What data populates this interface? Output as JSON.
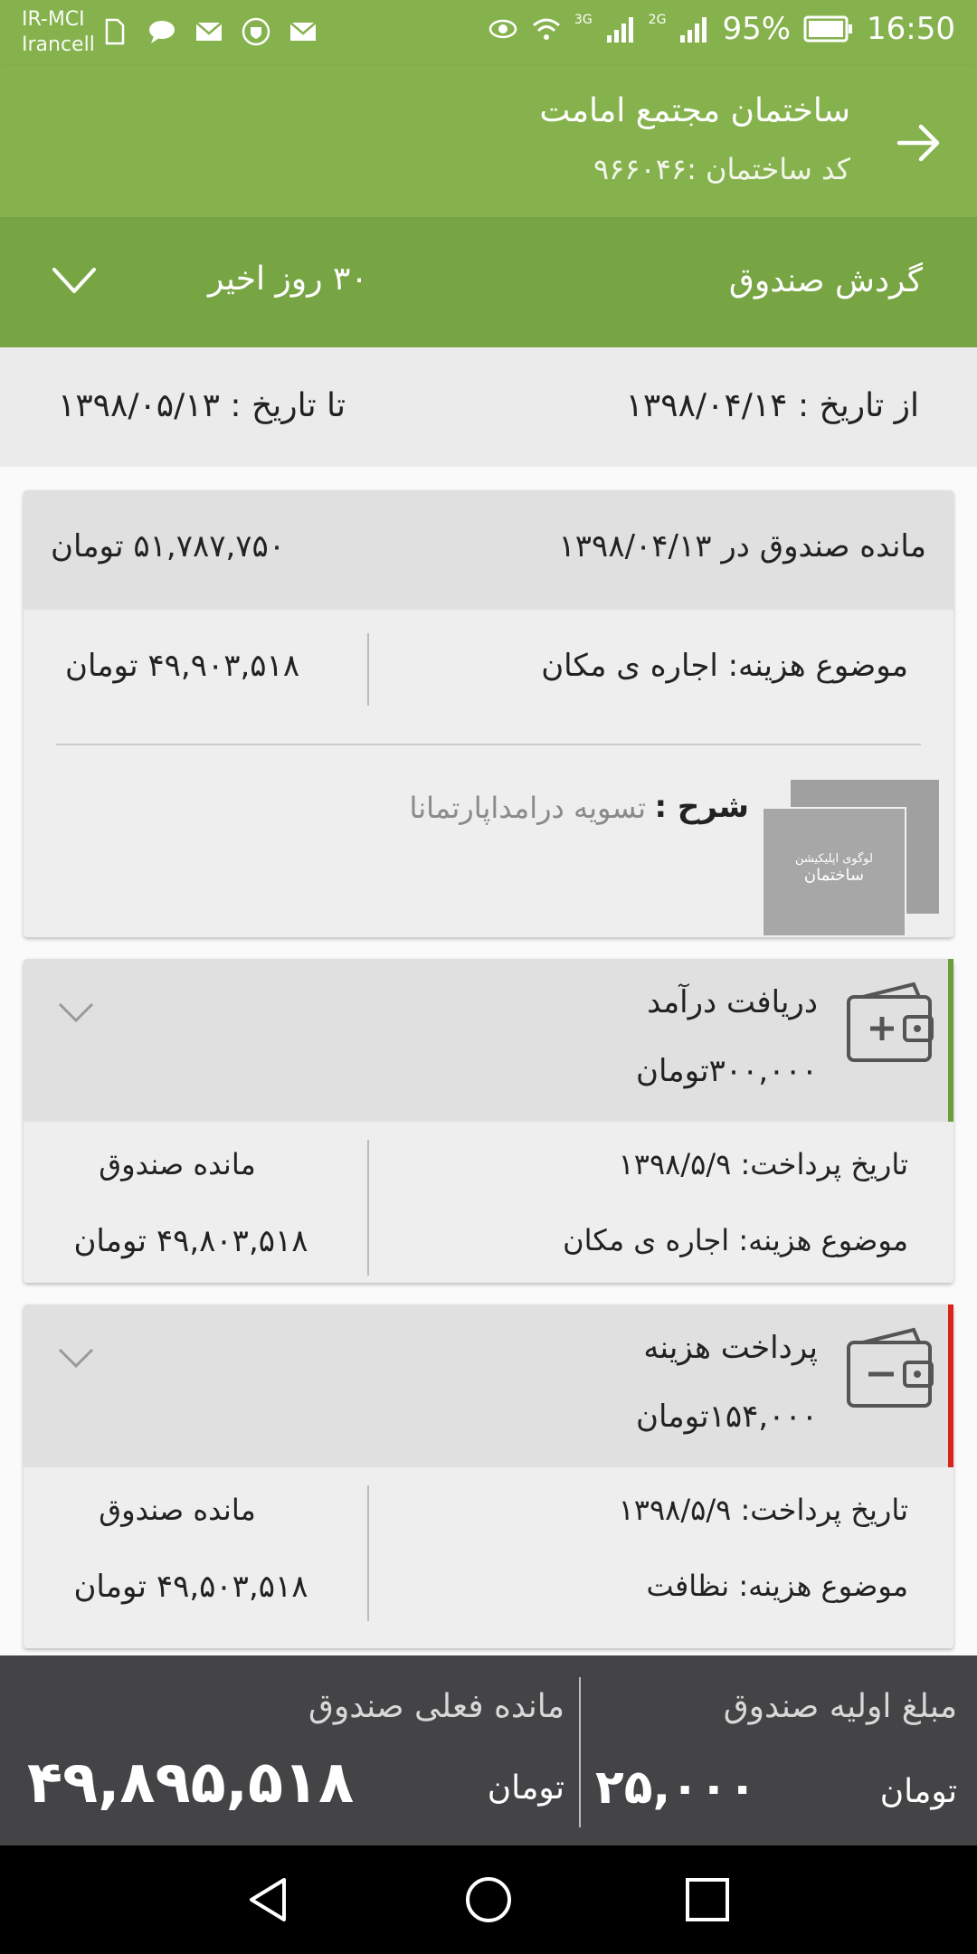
{
  "status_bar": {
    "carrier_line1": "IR-MCI",
    "carrier_line2": "Irancell",
    "battery": "95%",
    "time": "16:50",
    "network_3g": "3G",
    "network_2g": "2G"
  },
  "toolbar": {
    "title": "ساختمان مجتمع امامت",
    "subtitle": "کد ساختمان :۹۶۶۰۴۶"
  },
  "filter": {
    "label": "گردش صندوق",
    "period": "۳۰ روز اخیر"
  },
  "date_range": {
    "from": "از تاریخ : ۱۳۹۸/۰۴/۱۴",
    "to": "تا تاریخ : ۱۳۹۸/۰۵/۱۳"
  },
  "balance_card": {
    "title": "مانده صندوق در ۱۳۹۸/۰۴/۱۳",
    "amount": "۵۱,۷۸۷,۷۵۰ تومان",
    "subject": "موضوع هزینه: اجاره ی مکان",
    "subject_amount": "۴۹,۹۰۳,۵۱۸ تومان",
    "desc_label": "شرح :",
    "desc_value": "تسویه درامداپارتمانا",
    "logo_line1": "لوگوی اپلیکیشن",
    "logo_line2": "ساختمان"
  },
  "transactions": [
    {
      "type": "دریافت درآمد",
      "amount": "۳۰۰,۰۰۰تومان",
      "date": "تاریخ پرداخت: ۱۳۹۸/۵/۹",
      "subject": "موضوع هزینه: اجاره ی مکان",
      "balance_label": "مانده صندوق",
      "balance": "۴۹,۸۰۳,۵۱۸ تومان",
      "accent": "#6a9e3a"
    },
    {
      "type": "پرداخت هزینه",
      "amount": "۱۵۴,۰۰۰تومان",
      "date": "تاریخ پرداخت: ۱۳۹۸/۵/۹",
      "subject": "موضوع هزینه: نظافت",
      "balance_label": "مانده صندوق",
      "balance": "۴۹,۵۰۳,۵۱۸ تومان",
      "accent": "#d9241c"
    }
  ],
  "summary": {
    "initial_label": "مبلغ اولیه صندوق",
    "initial_amount": "۲۵,۰۰۰",
    "initial_unit": "تومان",
    "current_label": "مانده فعلی صندوق",
    "current_amount": "۴۹,۸۹۵,۵۱۸",
    "current_unit": "تومان"
  },
  "colors": {
    "primary": "#86b24d",
    "primary_dark": "#78a543",
    "summary_bg": "#444446"
  }
}
